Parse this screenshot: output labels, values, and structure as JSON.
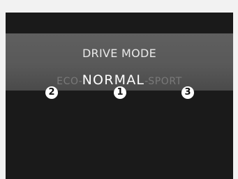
{
  "panel": {
    "title": "DRIVE MODE",
    "modes": {
      "eco": "ECO",
      "normal": "NORMAL",
      "sport": "SPORT",
      "separator": "-"
    },
    "callouts": [
      "2",
      "1",
      "3"
    ]
  },
  "colors": {
    "band": "#595959",
    "screen": "#1a1a1a",
    "active_mode": "#ffffff",
    "inactive_mode": "#7a7a7a"
  }
}
